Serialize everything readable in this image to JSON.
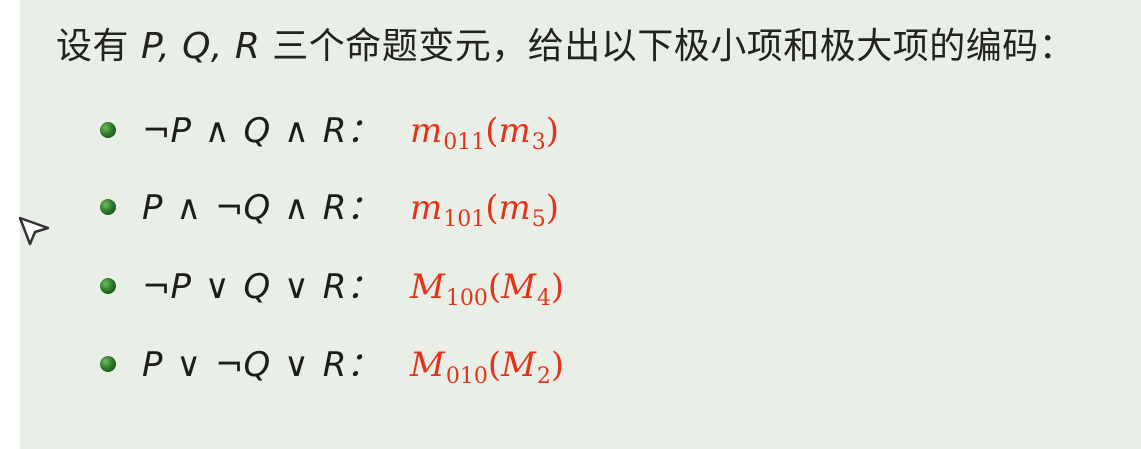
{
  "title": {
    "prefix": "设有 ",
    "vars": "P, Q, R",
    "suffix": " 三个命题变元，给出以下极小项和极大项的编码："
  },
  "items": [
    {
      "formula": "¬P ∧ Q ∧ R：",
      "code_symbol": "m",
      "code_index": "011",
      "alt_symbol": "m",
      "alt_index": "3"
    },
    {
      "formula": "P ∧ ¬Q ∧ R：",
      "code_symbol": "m",
      "code_index": "101",
      "alt_symbol": "m",
      "alt_index": "5"
    },
    {
      "formula": "¬P ∨ Q ∨ R：",
      "code_symbol": "M",
      "code_index": "100",
      "alt_symbol": "M",
      "alt_index": "4"
    },
    {
      "formula": "P ∨ ¬Q ∨ R：",
      "code_symbol": "M",
      "code_index": "010",
      "alt_symbol": "M",
      "alt_index": "2"
    }
  ],
  "colors": {
    "background": "#e9efe6",
    "text": "#222222",
    "highlight": "#e3341b",
    "bullet": "#2d7a2a"
  },
  "icons": {
    "bullet": "green-ball-bullet-icon",
    "cursor": "mouse-cursor-icon"
  }
}
